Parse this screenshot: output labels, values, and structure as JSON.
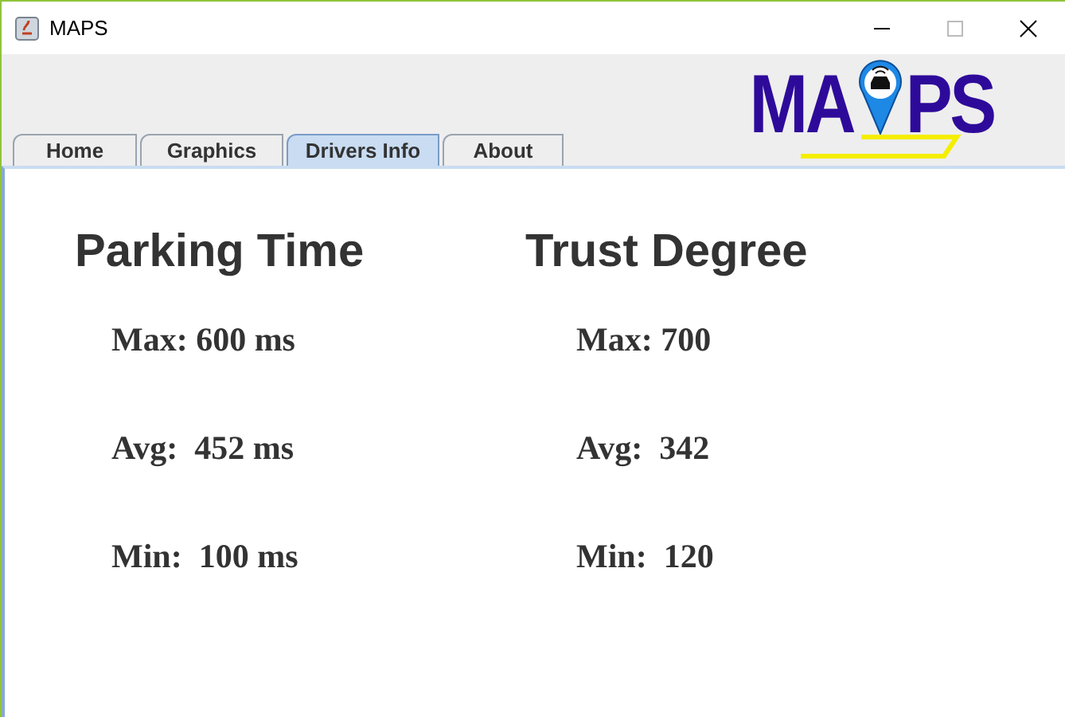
{
  "window": {
    "title": "MAPS"
  },
  "logo": {
    "left": "MA",
    "right": "PS"
  },
  "tabs": [
    {
      "label": "Home",
      "selected": false
    },
    {
      "label": "Graphics",
      "selected": false
    },
    {
      "label": "Drivers Info",
      "selected": true
    },
    {
      "label": "About",
      "selected": false
    }
  ],
  "panels": [
    {
      "title": "Parking Time",
      "stats": [
        "Max: 600 ms",
        "Avg:  452 ms",
        "Min:  100 ms"
      ]
    },
    {
      "title": "Trust Degree",
      "stats": [
        "Max: 700",
        "Avg:  342",
        "Min:  120"
      ]
    }
  ]
}
